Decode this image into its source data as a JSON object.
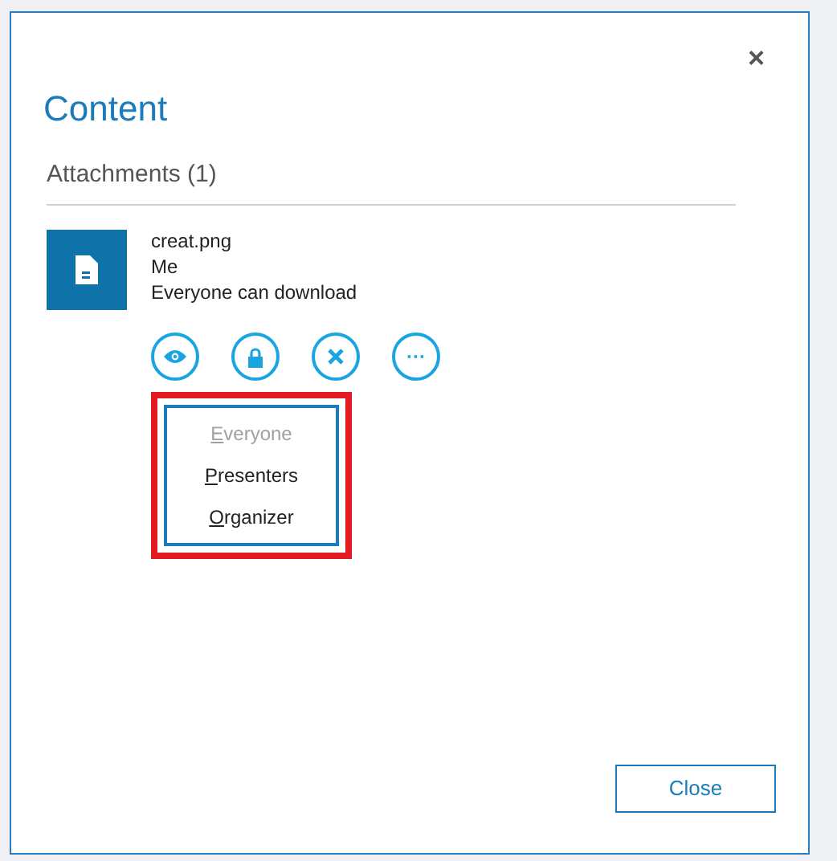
{
  "dialog": {
    "title": "Content",
    "close_glyph": "×"
  },
  "section": {
    "heading": "Attachments (1)"
  },
  "attachment": {
    "name": "creat.png",
    "owner": "Me",
    "permission": "Everyone can download"
  },
  "actions": [
    {
      "kind": "view"
    },
    {
      "kind": "lock"
    },
    {
      "kind": "remove"
    },
    {
      "kind": "more",
      "glyph": "···"
    }
  ],
  "menu": {
    "highlighted": true,
    "items": [
      {
        "label": "Everyone",
        "disabled": true
      },
      {
        "label": "Presenters",
        "disabled": false
      },
      {
        "label": "Organizer",
        "disabled": false
      }
    ]
  },
  "footer": {
    "button": "Close"
  }
}
